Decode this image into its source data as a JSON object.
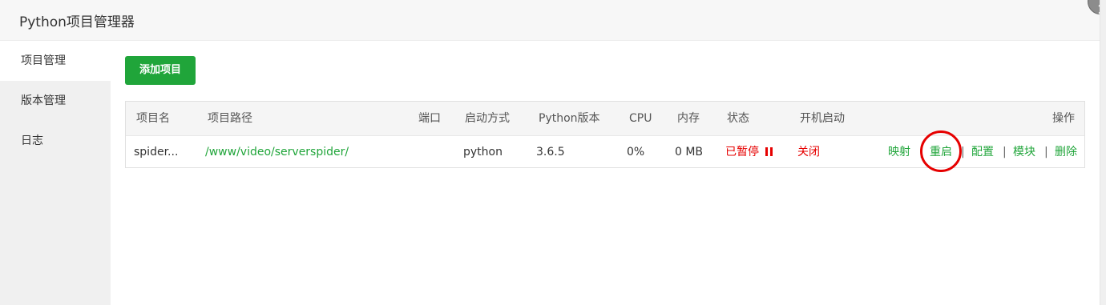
{
  "window": {
    "title": "Python项目管理器"
  },
  "sidebar": {
    "items": [
      {
        "label": "项目管理"
      },
      {
        "label": "版本管理"
      },
      {
        "label": "日志"
      }
    ]
  },
  "toolbar": {
    "add_label": "添加项目"
  },
  "table": {
    "headers": [
      "项目名",
      "项目路径",
      "端口",
      "启动方式",
      "Python版本",
      "CPU",
      "内存",
      "状态",
      "开机启动",
      "操作"
    ],
    "rows": [
      {
        "name": "spider...",
        "path": "/www/video/serverspider/",
        "port": "",
        "start_mode": "python",
        "python_version": "3.6.5",
        "cpu": "0%",
        "memory": "0 MB",
        "status": "已暂停",
        "autostart": "关闭",
        "actions": [
          "映射",
          "重启",
          "配置",
          "模块",
          "删除"
        ]
      }
    ]
  },
  "separator": "|",
  "colors": {
    "accent": "#20a53a",
    "danger": "#e60000"
  },
  "icons": {
    "status": "pause-icon",
    "close": "close-icon"
  }
}
